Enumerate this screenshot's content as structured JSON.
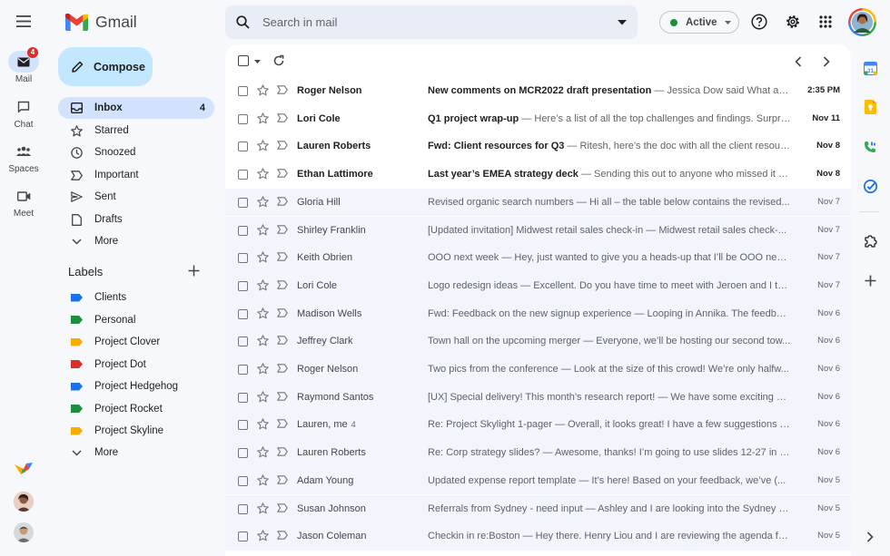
{
  "app": {
    "name": "Gmail"
  },
  "rail": [
    {
      "label": "Mail",
      "badge": "4"
    },
    {
      "label": "Chat"
    },
    {
      "label": "Spaces"
    },
    {
      "label": "Meet"
    }
  ],
  "compose": {
    "label": "Compose"
  },
  "nav": [
    {
      "label": "Inbox",
      "count": "4"
    },
    {
      "label": "Starred"
    },
    {
      "label": "Snoozed"
    },
    {
      "label": "Important"
    },
    {
      "label": "Sent"
    },
    {
      "label": "Drafts"
    },
    {
      "label": "More"
    }
  ],
  "labels": {
    "heading": "Labels",
    "items": [
      {
        "label": "Clients",
        "color": "#1a73e8"
      },
      {
        "label": "Personal",
        "color": "#1e8e3e"
      },
      {
        "label": "Project Clover",
        "color": "#f9ab00"
      },
      {
        "label": "Project Dot",
        "color": "#d93025"
      },
      {
        "label": "Project Hedgehog",
        "color": "#1a73e8"
      },
      {
        "label": "Project Rocket",
        "color": "#1e8e3e"
      },
      {
        "label": "Project Skyline",
        "color": "#f9ab00"
      }
    ],
    "more": "More"
  },
  "search": {
    "placeholder": "Search in mail"
  },
  "status": {
    "label": "Active",
    "color": "#1e8e3e"
  },
  "emails": [
    {
      "sender": "Roger Nelson",
      "subject": "New comments on MCR2022 draft presentation",
      "snippet": "Jessica Dow said What ab...",
      "date": "2:35 PM",
      "unread": true
    },
    {
      "sender": "Lori Cole",
      "subject": "Q1 project wrap-up",
      "snippet": "Here’s a list of all the top challenges and findings. Surpri...",
      "date": "Nov 11",
      "unread": true
    },
    {
      "sender": "Lauren Roberts",
      "subject": "Fwd: Client resources for Q3",
      "snippet": "Ritesh, here’s the doc with all the client resour...",
      "date": "Nov 8",
      "unread": true
    },
    {
      "sender": "Ethan Lattimore",
      "subject": "Last year’s EMEA strategy deck",
      "snippet": "Sending this out to anyone who missed it R...",
      "date": "Nov 8",
      "unread": true
    },
    {
      "sender": "Gloria Hill",
      "subject": "Revised organic search numbers",
      "snippet": "Hi all – the table below contains the revised...",
      "date": "Nov 7",
      "unread": false
    },
    {
      "sender": "Shirley Franklin",
      "subject": "[Updated invitation] Midwest retail sales check-in",
      "snippet": "Midwest retail sales check-...",
      "date": "Nov 7",
      "unread": false
    },
    {
      "sender": "Keith Obrien",
      "subject": "OOO next week",
      "snippet": "Hey, just wanted to give you a heads-up that I’ll be OOO next...",
      "date": "Nov 7",
      "unread": false
    },
    {
      "sender": "Lori Cole",
      "subject": "Logo redesign ideas",
      "snippet": "Excellent. Do you have time to meet with Jeroen and I thi...",
      "date": "Nov 7",
      "unread": false
    },
    {
      "sender": "Madison Wells",
      "subject": "Fwd: Feedback on the new signup experience",
      "snippet": "Looping in Annika. The feedbac...",
      "date": "Nov 6",
      "unread": false
    },
    {
      "sender": "Jeffrey Clark",
      "subject": "Town hall on the upcoming merger",
      "snippet": "Everyone, we’ll be hosting our second tow...",
      "date": "Nov 6",
      "unread": false
    },
    {
      "sender": "Roger Nelson",
      "subject": "Two pics from the conference",
      "snippet": "Look at the size of this crowd! We’re only halfw...",
      "date": "Nov 6",
      "unread": false
    },
    {
      "sender": "Raymond Santos",
      "subject": "[UX] Special delivery! This month’s research report!",
      "snippet": "We have some exciting st...",
      "date": "Nov 6",
      "unread": false
    },
    {
      "sender": "Lauren, me",
      "count": "4",
      "subject": "Re: Project Skylight 1-pager",
      "snippet": "Overall, it looks great! I have a few suggestions fo...",
      "date": "Nov 6",
      "unread": false
    },
    {
      "sender": "Lauren Roberts",
      "subject": "Re: Corp strategy slides?",
      "snippet": "Awesome, thanks! I’m going to use slides 12-27 in m...",
      "date": "Nov 6",
      "unread": false
    },
    {
      "sender": "Adam Young",
      "subject": "Updated expense report template",
      "snippet": "It’s here! Based on your feedback, we’ve (...",
      "date": "Nov 5",
      "unread": false
    },
    {
      "sender": "Susan Johnson",
      "subject": "Referrals from Sydney - need input",
      "snippet": "Ashley and I are looking into the Sydney m...",
      "date": "Nov 5",
      "unread": false
    },
    {
      "sender": "Jason Coleman",
      "subject": "Checkin in re:Boston",
      "snippet": "Hey there. Henry Liou and I are reviewing the agenda for...",
      "date": "Nov 5",
      "unread": false
    }
  ]
}
